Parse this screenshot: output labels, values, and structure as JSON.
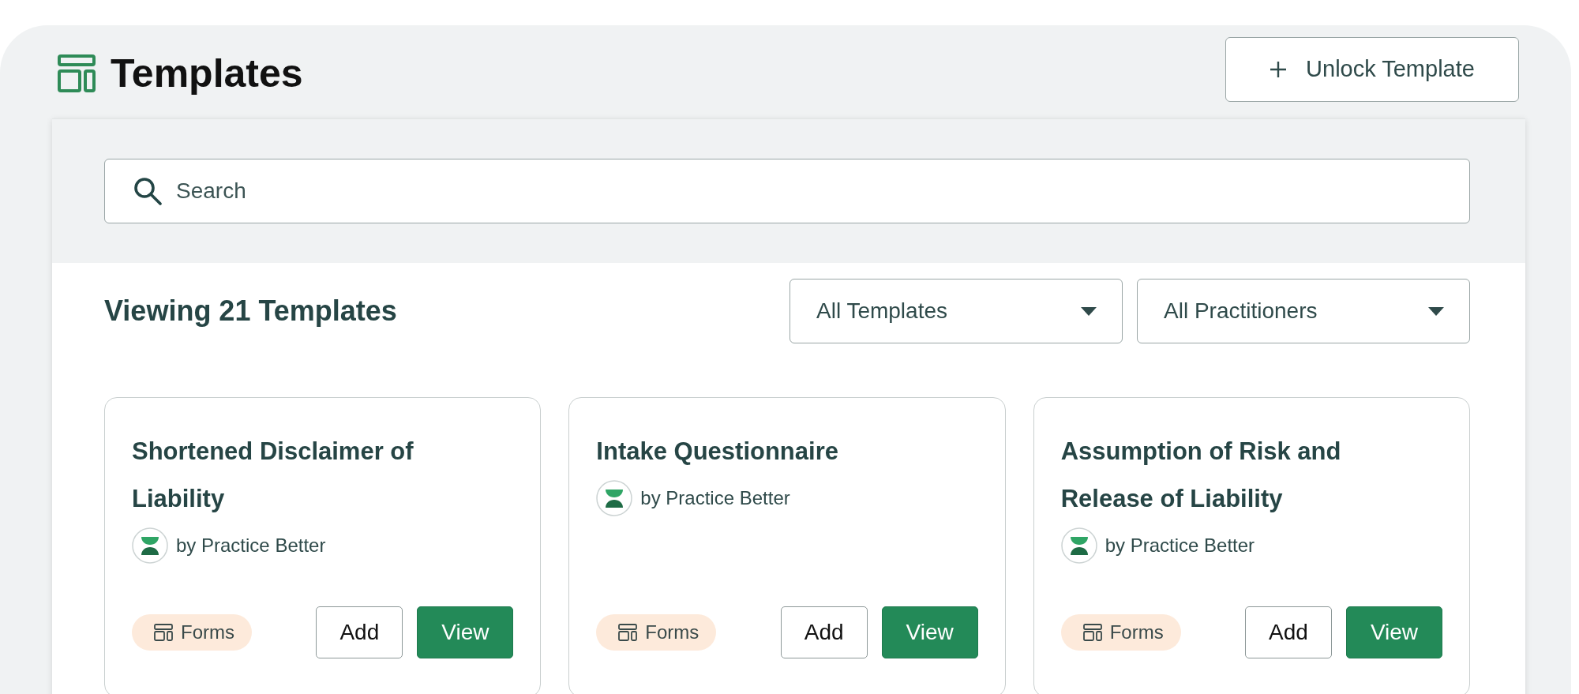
{
  "header": {
    "title": "Templates",
    "unlock_button": "Unlock Template"
  },
  "search": {
    "placeholder": "Search"
  },
  "summary": "Viewing 21 Templates",
  "filters": [
    {
      "label": "All Templates"
    },
    {
      "label": "All Practitioners"
    }
  ],
  "cards": [
    {
      "title": "Shortened Disclaimer of Liability",
      "author": "by Practice Better",
      "tag": "Forms",
      "add": "Add",
      "view": "View"
    },
    {
      "title": "Intake Questionnaire",
      "author": "by Practice Better",
      "tag": "Forms",
      "add": "Add",
      "view": "View"
    },
    {
      "title": "Assumption of Risk and Release of Liability",
      "author": "by Practice Better",
      "tag": "Forms",
      "add": "Add",
      "view": "View"
    }
  ]
}
